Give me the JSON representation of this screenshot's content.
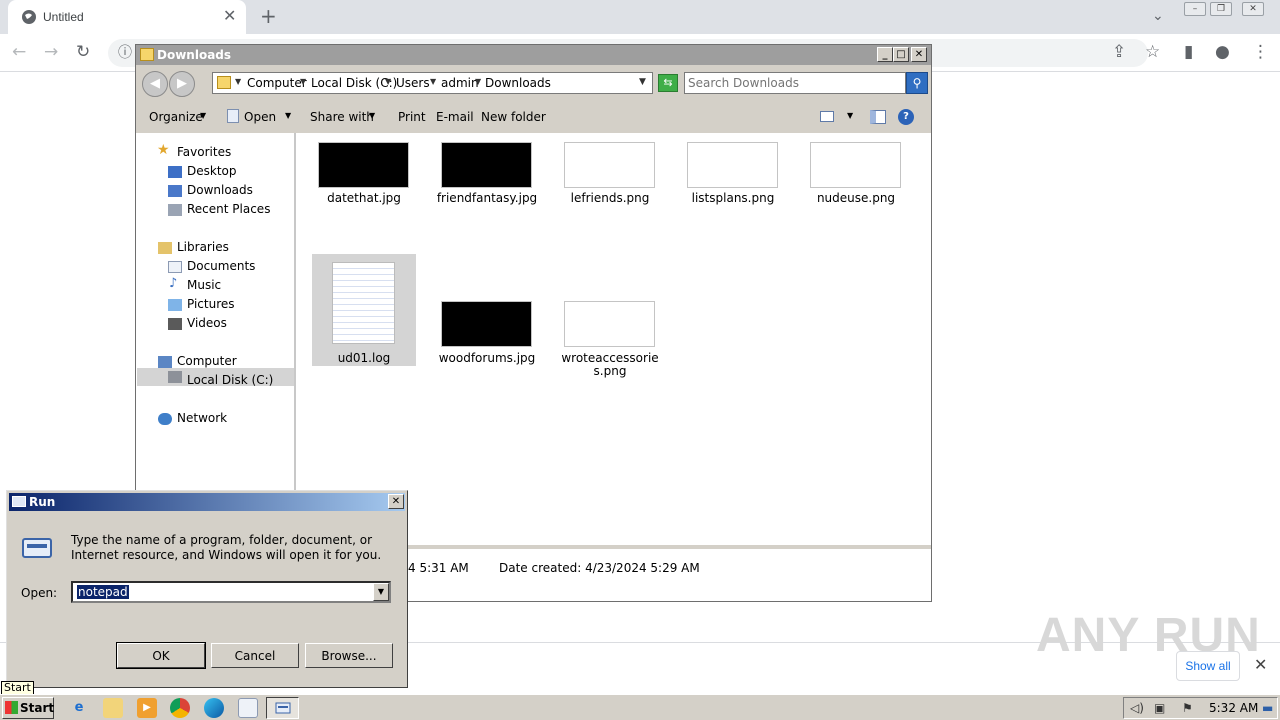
{
  "browser": {
    "tab_title": "Untitled",
    "new_tab_icon": "+",
    "download_bar": {
      "show_all_label": "Show all"
    },
    "watermark": "ANY RUN"
  },
  "explorer": {
    "title": "Downloads",
    "breadcrumb": [
      "Computer",
      "Local Disk (C:)",
      "Users",
      "admin",
      "Downloads"
    ],
    "search_placeholder": "Search Downloads",
    "toolbar": {
      "organize": "Organize",
      "open": "Open",
      "share_with": "Share with",
      "print": "Print",
      "email": "E-mail",
      "new_folder": "New folder"
    },
    "nav": {
      "favorites": "Favorites",
      "desktop": "Desktop",
      "downloads": "Downloads",
      "recent_places": "Recent Places",
      "libraries": "Libraries",
      "documents": "Documents",
      "music": "Music",
      "pictures": "Pictures",
      "videos": "Videos",
      "computer": "Computer",
      "local_disk": "Local Disk (C:)",
      "network": "Network"
    },
    "files": [
      {
        "name": "datethat.jpg",
        "thumb": "dark"
      },
      {
        "name": "friendfantasy.jpg",
        "thumb": "dark"
      },
      {
        "name": "lefriends.png",
        "thumb": "light"
      },
      {
        "name": "listsplans.png",
        "thumb": "light"
      },
      {
        "name": "nudeuse.png",
        "thumb": "light"
      },
      {
        "name": "ud01.log",
        "thumb": "document",
        "selected": true
      },
      {
        "name": "woodforums.jpg",
        "thumb": "dark"
      },
      {
        "name": "wroteaccessories.png",
        "thumb": "light"
      }
    ],
    "details": {
      "date_modified_partial": "4 5:31 AM",
      "date_created": "Date created:  4/23/2024 5:29 AM"
    }
  },
  "run_dialog": {
    "title": "Run",
    "description": "Type the name of a program, folder, document, or Internet resource, and Windows will open it for you.",
    "open_label": "Open:",
    "open_value": "notepad",
    "ok_label": "OK",
    "cancel_label": "Cancel",
    "browse_label": "Browse..."
  },
  "taskbar": {
    "start_label": "Start",
    "start_tooltip": "Start",
    "clock": "5:32 AM"
  }
}
